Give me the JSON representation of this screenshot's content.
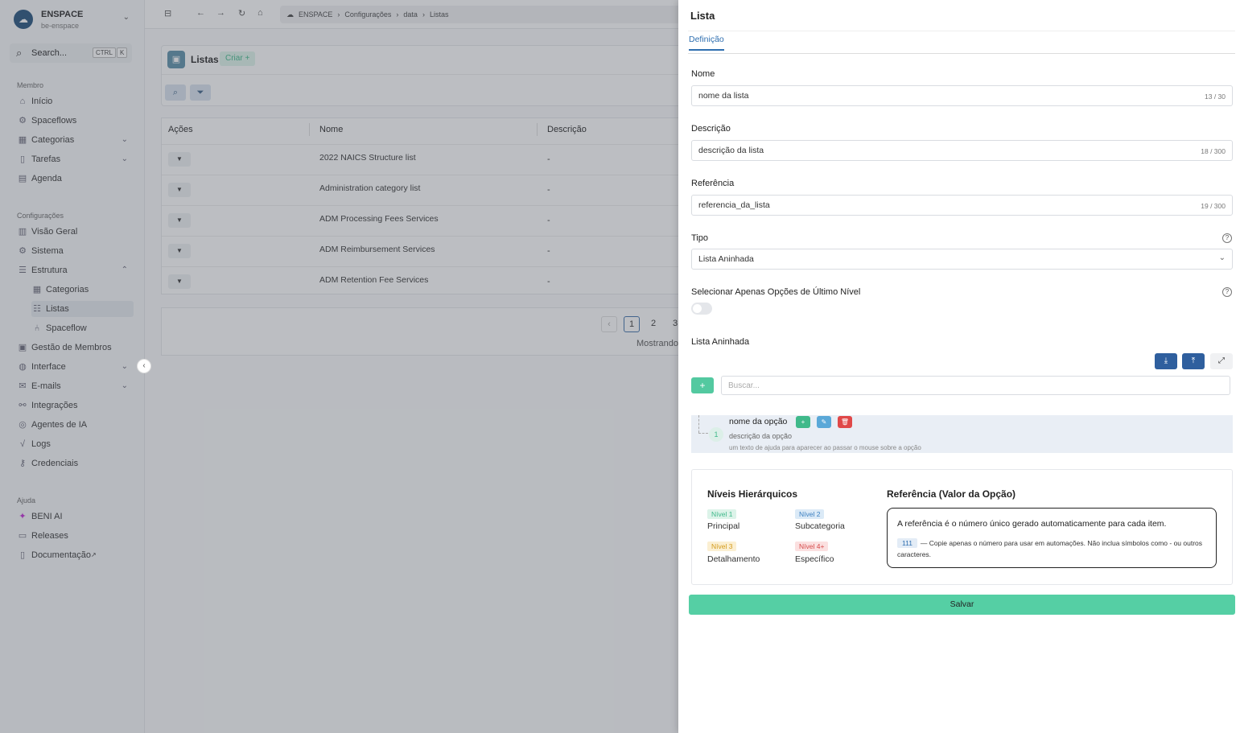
{
  "workspace": {
    "logo": "☁",
    "name": "ENSPACE",
    "subtitle": "be-enspace"
  },
  "search": {
    "label": "Search...",
    "key1": "CTRL",
    "key2": "K"
  },
  "sections": {
    "member": "Membro",
    "config": "Configurações",
    "help": "Ajuda"
  },
  "nav": {
    "inicio": "Início",
    "spaceflows": "Spaceflows",
    "categorias": "Categorias",
    "tarefas": "Tarefas",
    "agenda": "Agenda",
    "visao_geral": "Visão Geral",
    "sistema": "Sistema",
    "estrutura": "Estrutura",
    "sub_categorias": "Categorias",
    "sub_listas": "Listas",
    "sub_spaceflow": "Spaceflow",
    "gestao_membros": "Gestão de Membros",
    "interface": "Interface",
    "emails": "E-mails",
    "integracoes": "Integrações",
    "agentes_ia": "Agentes de IA",
    "logs": "Logs",
    "credenciais": "Credenciais",
    "beni_ai": "BENI AI",
    "releases": "Releases",
    "documentacao": "Documentação"
  },
  "breadcrumb": [
    "ENSPACE",
    "Configurações",
    "data",
    "Listas"
  ],
  "page": {
    "title": "Listas",
    "create": "Criar +"
  },
  "table": {
    "headers": [
      "Ações",
      "Nome",
      "Descrição"
    ],
    "rows": [
      {
        "name": "2022 NAICS Structure list",
        "desc": "-"
      },
      {
        "name": "Administration category list",
        "desc": "-"
      },
      {
        "name": "ADM Processing Fees Services",
        "desc": "-"
      },
      {
        "name": "ADM Reimbursement Services",
        "desc": "-"
      },
      {
        "name": "ADM Retention Fee Services",
        "desc": "-"
      }
    ]
  },
  "pagination": {
    "pages": [
      "1",
      "2",
      "3"
    ],
    "showing": "Mostrando"
  },
  "panel": {
    "title": "Lista",
    "tab": "Definição",
    "nome_label": "Nome",
    "nome_value": "nome da lista",
    "nome_count": "13 / 30",
    "desc_label": "Descrição",
    "desc_value": "descrição da lista",
    "desc_count": "18 / 300",
    "ref_label": "Referência",
    "ref_value": "referencia_da_lista",
    "ref_count": "19 / 300",
    "tipo_label": "Tipo",
    "tipo_value": "Lista Aninhada",
    "ultimo_label": "Selecionar Apenas Opções de Último Nível",
    "toggle_on": false,
    "nested_label": "Lista Aninhada",
    "buscar_placeholder": "Buscar...",
    "option": {
      "level": "1",
      "name": "nome da opção",
      "desc": "descrição da opção",
      "help": "um texto de ajuda para aparecer ao passar o mouse sobre a opção"
    },
    "levels_title": "Níveis Hierárquicos",
    "levels": [
      {
        "tag": "Nível 1",
        "label": "Principal",
        "bg": "#dcf3e9",
        "fg": "#3fb98a"
      },
      {
        "tag": "Nível 2",
        "label": "Subcategoria",
        "bg": "#dbeaf7",
        "fg": "#3b7fc0"
      },
      {
        "tag": "Nível 3",
        "label": "Detalhamento",
        "bg": "#fbefd2",
        "fg": "#d39a1b"
      },
      {
        "tag": "Nível 4+",
        "label": "Específico",
        "bg": "#fbe0e0",
        "fg": "#d64a4a"
      }
    ],
    "ref_title": "Referência (Valor da Opção)",
    "ref_text1": "A referência é o número único gerado automaticamente para cada item.",
    "ref_tag": "111",
    "ref_text2": "— Copie apenas o número para usar em automações. Não inclua símbolos como - ou outros caracteres.",
    "save": "Salvar"
  }
}
